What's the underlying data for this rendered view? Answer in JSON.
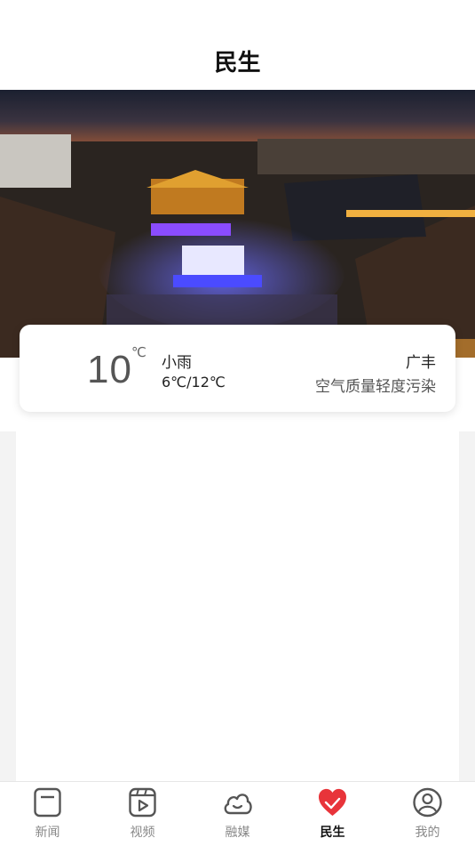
{
  "header": {
    "title": "民生"
  },
  "weather": {
    "temperature": "10",
    "unit": "℃",
    "condition": "小雨",
    "range": "6℃/12℃",
    "city": "广丰",
    "air_quality": "空气质量轻度污染"
  },
  "tabs": [
    {
      "label": "新闻",
      "icon": "news-icon",
      "active": false
    },
    {
      "label": "视频",
      "icon": "video-icon",
      "active": false
    },
    {
      "label": "融媒",
      "icon": "cloud-icon",
      "active": false
    },
    {
      "label": "民生",
      "icon": "heart-hands-icon",
      "active": true
    },
    {
      "label": "我的",
      "icon": "user-icon",
      "active": false
    }
  ],
  "colors": {
    "active_tab": "#e8343a",
    "inactive_icon": "#555555"
  }
}
